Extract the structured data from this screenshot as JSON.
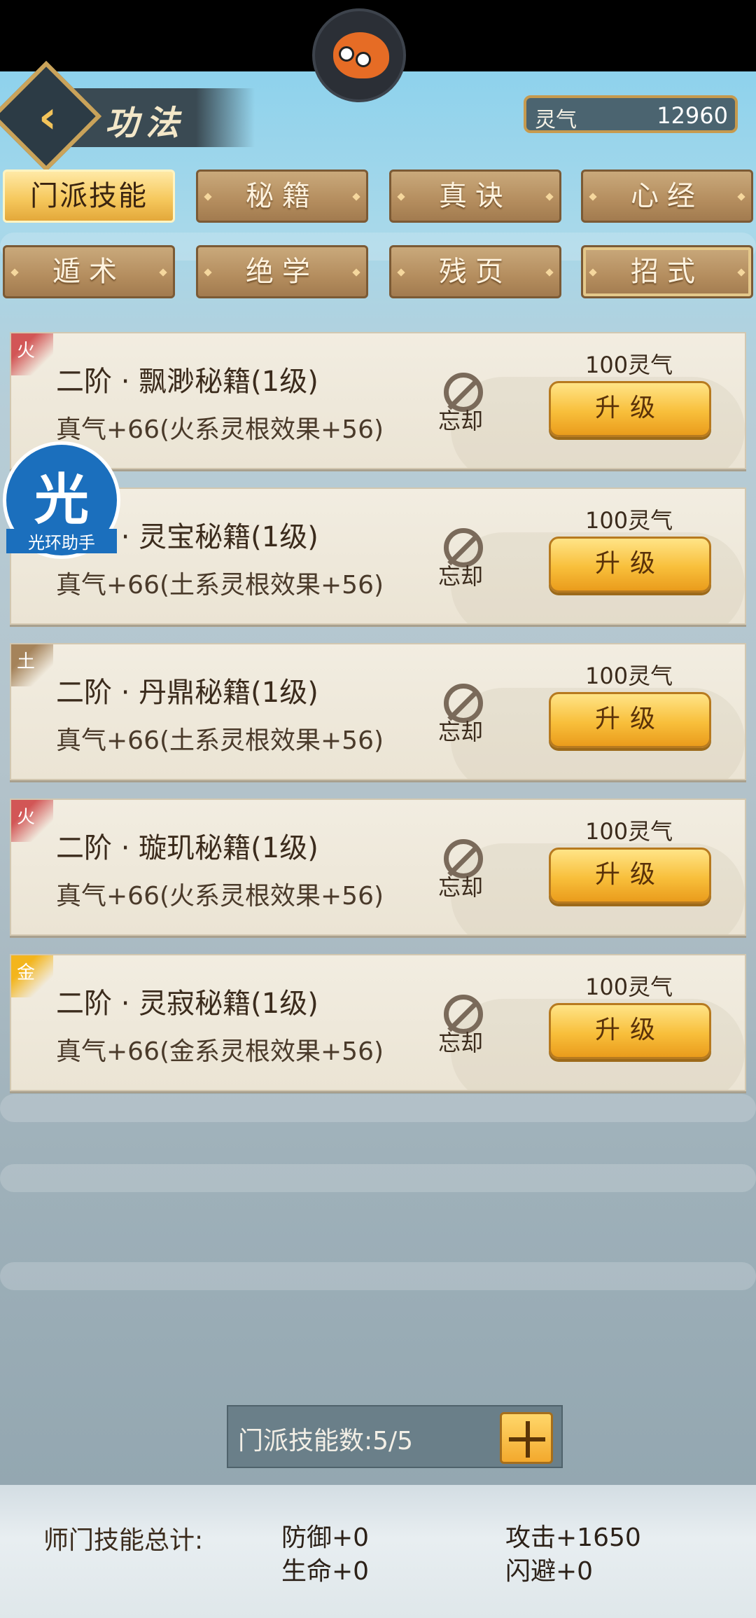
{
  "header": {
    "title": "功法",
    "lingqi_label": "灵气",
    "lingqi_value": "12960"
  },
  "tabs": [
    {
      "label": "门派技能",
      "active": true
    },
    {
      "label": "秘籍",
      "active": false
    },
    {
      "label": "真诀",
      "active": false
    },
    {
      "label": "心经",
      "active": false
    },
    {
      "label": "遁术",
      "active": false
    },
    {
      "label": "绝学",
      "active": false
    },
    {
      "label": "残页",
      "active": false
    },
    {
      "label": "招式",
      "active": false
    }
  ],
  "skills": [
    {
      "element": "火",
      "element_color": "#d25656",
      "name": "二阶 · 飘渺秘籍(1级)",
      "effect": "真气+66(火系灵根效果+56)",
      "forget_label": "忘却",
      "cost": "100灵气",
      "upgrade_label": "升级"
    },
    {
      "element": "",
      "element_color": "#ebe4d4",
      "name": "二阶 · 灵宝秘籍(1级)",
      "effect": "真气+66(土系灵根效果+56)",
      "forget_label": "忘却",
      "cost": "100灵气",
      "upgrade_label": "升级"
    },
    {
      "element": "土",
      "element_color": "#a5835a",
      "name": "二阶 · 丹鼎秘籍(1级)",
      "effect": "真气+66(土系灵根效果+56)",
      "forget_label": "忘却",
      "cost": "100灵气",
      "upgrade_label": "升级"
    },
    {
      "element": "火",
      "element_color": "#d25656",
      "name": "二阶 · 璇玑秘籍(1级)",
      "effect": "真气+66(火系灵根效果+56)",
      "forget_label": "忘却",
      "cost": "100灵气",
      "upgrade_label": "升级"
    },
    {
      "element": "金",
      "element_color": "#f3b51d",
      "name": "二阶 · 灵寂秘籍(1级)",
      "effect": "真气+66(金系灵根效果+56)",
      "forget_label": "忘却",
      "cost": "100灵气",
      "upgrade_label": "升级"
    }
  ],
  "overlay_badge": {
    "glyph": "光",
    "text": "光环助手"
  },
  "count_bar": {
    "text": "门派技能数:5/5"
  },
  "summary": {
    "label": "师门技能总计:",
    "defense": "防御+0",
    "attack": "攻击+1650",
    "hp": "生命+0",
    "dodge": "闪避+0"
  }
}
